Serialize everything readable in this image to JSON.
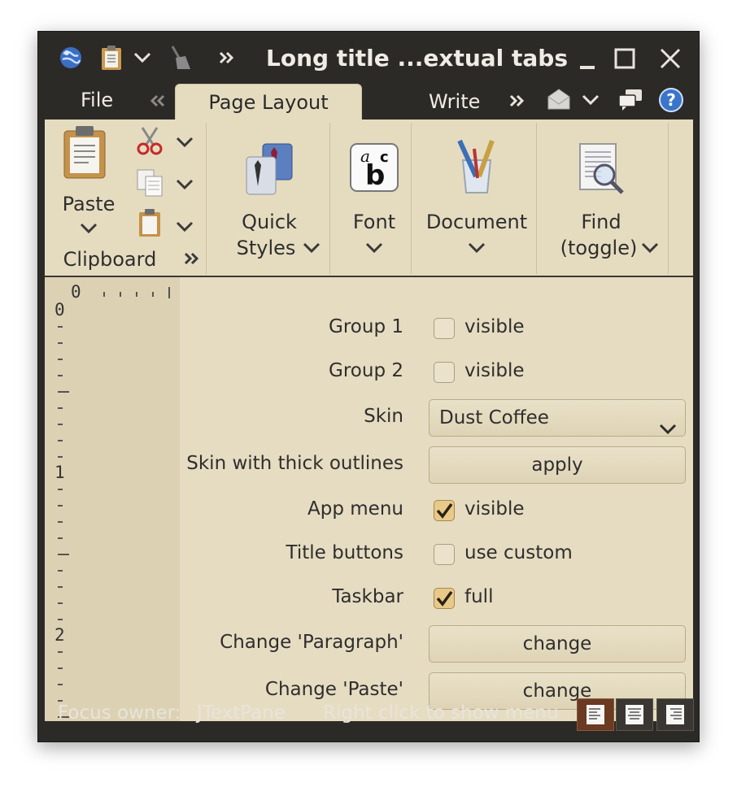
{
  "window": {
    "title": "Long title ...extual tabs"
  },
  "titlebar": {
    "icons": [
      "globe-icon",
      "clipboard-icon",
      "chevron-down-icon",
      "broom-icon",
      "double-chevron-right-icon"
    ],
    "buttons": [
      "minimize-icon",
      "maximize-icon",
      "close-icon"
    ]
  },
  "tabs": {
    "file_label": "File",
    "active_label": "Page Layout",
    "write_label": "Write",
    "right_icons": [
      "envelope-icon",
      "chevron-down-icon",
      "chat-bubbles-icon",
      "help-icon"
    ]
  },
  "ribbon": {
    "clipboard": {
      "paste_label": "Paste",
      "band_title": "Clipboard"
    },
    "quick_styles_label_1": "Quick",
    "quick_styles_label_2": "Styles",
    "font_label": "Font",
    "document_label": "Document",
    "find_label_1": "Find",
    "find_label_2": "(toggle)"
  },
  "ruler": {
    "top_zero": "0",
    "left_numbers": [
      "0",
      "1",
      "2"
    ]
  },
  "form": {
    "group1_label": "Group 1",
    "group1_check": "visible",
    "group1_checked": false,
    "group2_label": "Group 2",
    "group2_check": "visible",
    "group2_checked": false,
    "skin_label": "Skin",
    "skin_value": "Dust Coffee",
    "thick_label": "Skin with thick outlines",
    "thick_button": "apply",
    "appmenu_label": "App menu",
    "appmenu_check": "visible",
    "appmenu_checked": true,
    "titlebuttons_label": "Title buttons",
    "titlebuttons_check": "use custom",
    "titlebuttons_checked": false,
    "taskbar_label": "Taskbar",
    "taskbar_check": "full",
    "taskbar_checked": true,
    "paragraph_label": "Change 'Paragraph'",
    "paragraph_button": "change",
    "paste_label": "Change 'Paste'",
    "paste_button": "change"
  },
  "status": {
    "focus_label": "Focus owner:",
    "focus_value": "JTextPane",
    "hint": "Right click to show menu"
  },
  "colors": {
    "chrome": "#2c2a27",
    "ribbon": "#e5dcc0",
    "content": "#e6dcc1",
    "checkbox_checked": "#e8c98a"
  }
}
